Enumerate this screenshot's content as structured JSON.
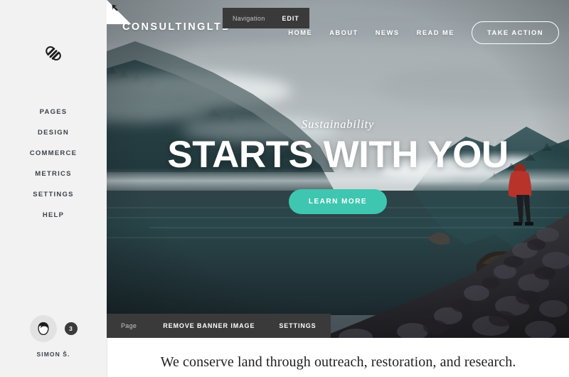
{
  "sidebar": {
    "logo_icon": "squarespace-logo-icon",
    "items": [
      {
        "label": "PAGES"
      },
      {
        "label": "DESIGN"
      },
      {
        "label": "COMMERCE"
      },
      {
        "label": "METRICS"
      },
      {
        "label": "SETTINGS"
      },
      {
        "label": "HELP"
      }
    ],
    "account": {
      "avatar_icon": "user-avatar-icon",
      "notification_count": "3",
      "name": "SIMON Š."
    }
  },
  "canvas": {
    "corner_widget_icon": "collapse-arrow-icon",
    "nav_editor": {
      "label": "Navigation",
      "action": "EDIT"
    },
    "site": {
      "logo": "CONSULTINGLTD",
      "nav_links": [
        {
          "label": "HOME"
        },
        {
          "label": "ABOUT"
        },
        {
          "label": "NEWS"
        },
        {
          "label": "READ ME"
        }
      ],
      "cta": "TAKE ACTION"
    },
    "hero": {
      "eyebrow": "Sustainability",
      "title": "STARTS WITH YOU",
      "button": "LEARN MORE",
      "accent_color": "#3fc6b0"
    },
    "page_toolbar": {
      "label": "Page",
      "actions": [
        {
          "label": "REMOVE BANNER IMAGE"
        },
        {
          "label": "SETTINGS"
        }
      ]
    },
    "content": {
      "lead": "We conserve land through outreach, restoration, and research."
    }
  },
  "theme": {
    "sidebar_bg": "#f2f2f2",
    "toolbar_bg": "#3a3a3a",
    "accent": "#3fc6b0",
    "text_dark": "#3d4148"
  }
}
